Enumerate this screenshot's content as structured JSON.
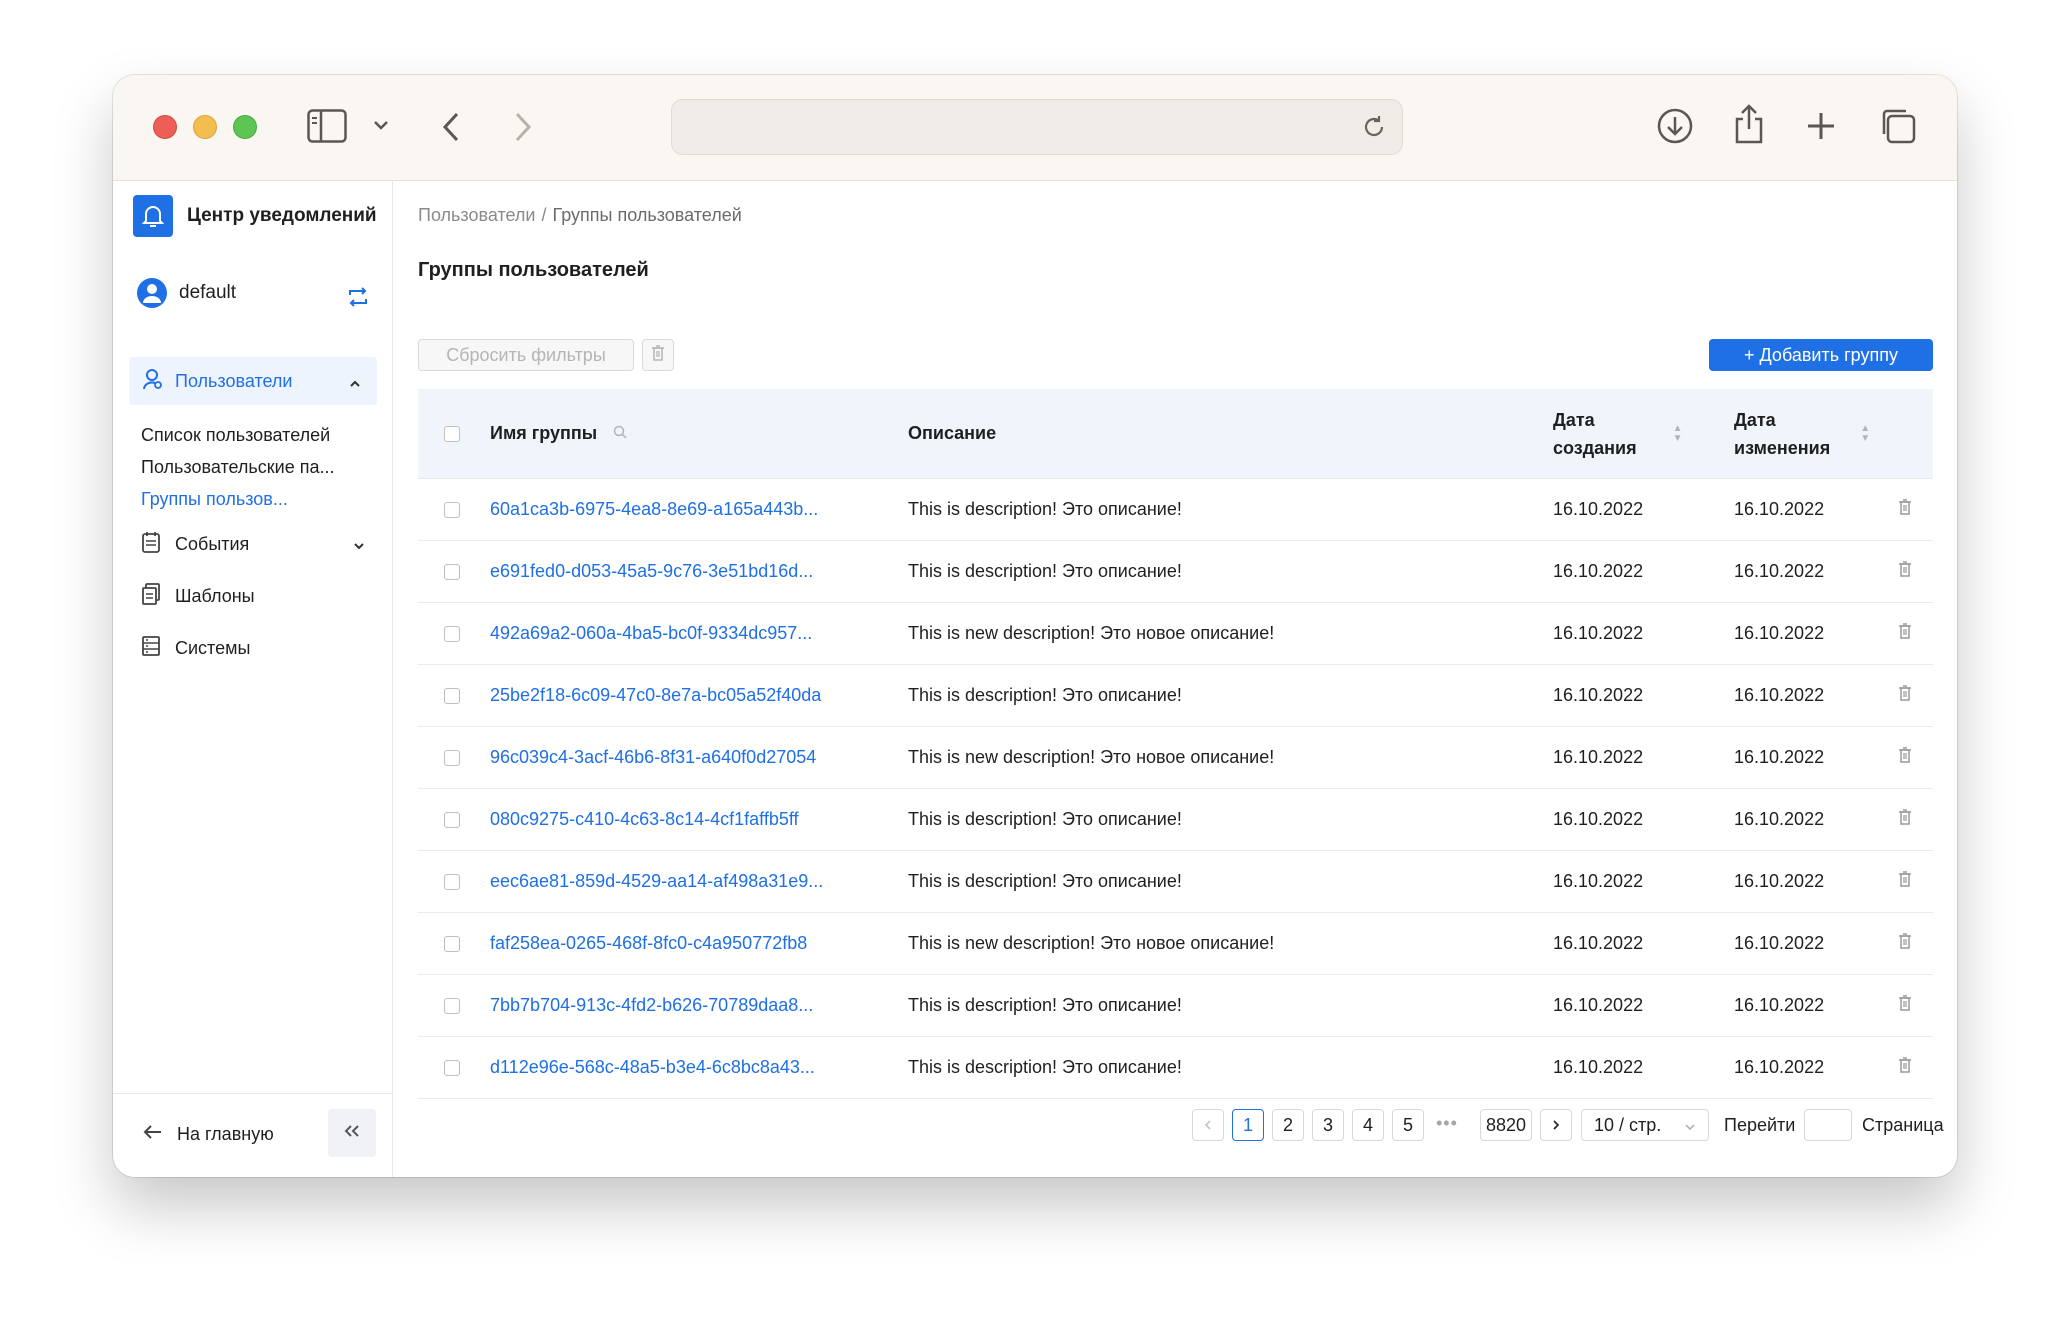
{
  "sidebar": {
    "brand": "Центр уведомлений",
    "user": "default",
    "nav_users": "Пользователи",
    "sub_items": [
      "Список пользователей",
      "Пользовательские па...",
      "Группы пользов..."
    ],
    "nav_events": "События",
    "nav_templates": "Шаблоны",
    "nav_systems": "Системы",
    "home": "На главную"
  },
  "breadcrumb": {
    "parent": "Пользователи",
    "separator": "/",
    "current": "Группы пользователей"
  },
  "page_title": "Группы пользователей",
  "toolbar": {
    "reset_label": "Сбросить фильтры",
    "add_label": "+ Добавить группу"
  },
  "table": {
    "columns": {
      "name": "Имя группы",
      "description": "Описание",
      "created_1": "Дата",
      "created_2": "создания",
      "modified_1": "Дата",
      "modified_2": "изменения"
    },
    "rows": [
      {
        "name": "60a1ca3b-6975-4ea8-8e69-a165a443b...",
        "description": "This is description! Это описание!",
        "created": "16.10.2022",
        "modified": "16.10.2022"
      },
      {
        "name": "e691fed0-d053-45a5-9c76-3e51bd16d...",
        "description": "This is description! Это описание!",
        "created": "16.10.2022",
        "modified": "16.10.2022"
      },
      {
        "name": "492a69a2-060a-4ba5-bc0f-9334dc957...",
        "description": "This is new description! Это новое описание!",
        "created": "16.10.2022",
        "modified": "16.10.2022"
      },
      {
        "name": "25be2f18-6c09-47c0-8e7a-bc05a52f40da",
        "description": "This is description! Это описание!",
        "created": "16.10.2022",
        "modified": "16.10.2022"
      },
      {
        "name": "96c039c4-3acf-46b6-8f31-a640f0d27054",
        "description": "This is new description! Это новое описание!",
        "created": "16.10.2022",
        "modified": "16.10.2022"
      },
      {
        "name": "080c9275-c410-4c63-8c14-4cf1faffb5ff",
        "description": "This is description! Это описание!",
        "created": "16.10.2022",
        "modified": "16.10.2022"
      },
      {
        "name": "eec6ae81-859d-4529-aa14-af498a31e9...",
        "description": "This is description! Это описание!",
        "created": "16.10.2022",
        "modified": "16.10.2022"
      },
      {
        "name": "faf258ea-0265-468f-8fc0-c4a950772fb8",
        "description": "This is new description! Это новое описание!",
        "created": "16.10.2022",
        "modified": "16.10.2022"
      },
      {
        "name": "7bb7b704-913c-4fd2-b626-70789daa8...",
        "description": "This is description! Это описание!",
        "created": "16.10.2022",
        "modified": "16.10.2022"
      },
      {
        "name": "d112e96e-568c-48a5-b3e4-6c8bc8a43...",
        "description": "This is description! Это описание!",
        "created": "16.10.2022",
        "modified": "16.10.2022"
      }
    ]
  },
  "pagination": {
    "pages": [
      "1",
      "2",
      "3",
      "4",
      "5"
    ],
    "current_page": "1",
    "dots": "•••",
    "last_page": "8820",
    "page_size": "10 / стр.",
    "goto_label": "Перейти",
    "page_label": "Страница"
  },
  "colors": {
    "accent": "#1f6fe5",
    "header_bg": "#f0f4fb",
    "toolbar_bg": "#faf6f2"
  }
}
